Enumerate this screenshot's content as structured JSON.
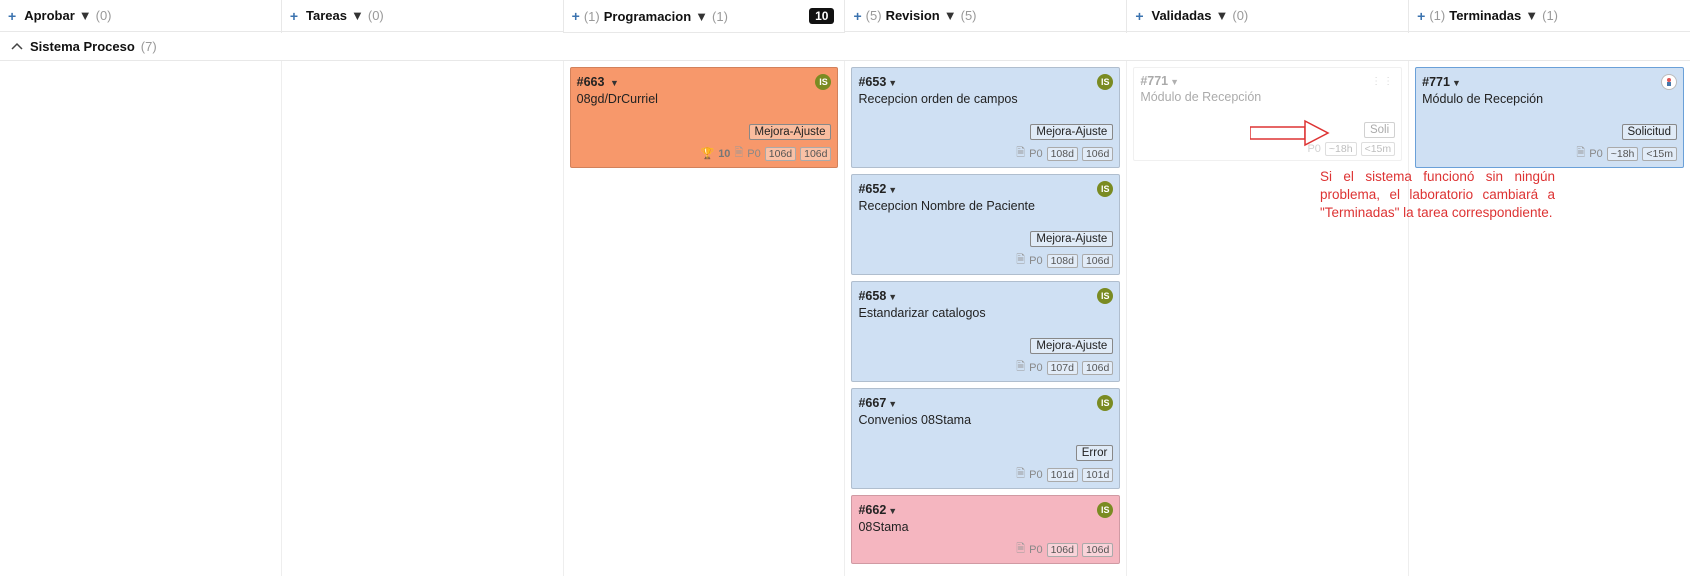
{
  "columns": [
    {
      "title": "Aprobar",
      "pre": "",
      "post": "(0)",
      "badge": ""
    },
    {
      "title": "Tareas",
      "pre": "",
      "post": "(0)",
      "badge": ""
    },
    {
      "title": "Programacion",
      "pre": "(1)",
      "post": "(1)",
      "badge": "10"
    },
    {
      "title": "Revision",
      "pre": "(5)",
      "post": "(5)",
      "badge": ""
    },
    {
      "title": "Validadas",
      "pre": "",
      "post": "(0)",
      "badge": ""
    },
    {
      "title": "Terminadas",
      "pre": "(1)",
      "post": "(1)",
      "badge": ""
    }
  ],
  "swimlane": {
    "name": "Sistema Proceso",
    "count": "(7)"
  },
  "cards": {
    "programacion": [
      {
        "id": "#663",
        "title": "08gd/DrCurriel",
        "tag": "Mejora-Ajuste",
        "avatar": "IS",
        "trophy": true,
        "points": "10",
        "prio": "P0",
        "pill1": "106d",
        "pill2": "106d",
        "color": "orange"
      }
    ],
    "revision": [
      {
        "id": "#653",
        "title": "Recepcion orden de campos",
        "tag": "Mejora-Ajuste",
        "avatar": "IS",
        "prio": "P0",
        "pill1": "108d",
        "pill2": "106d",
        "color": "blue"
      },
      {
        "id": "#652",
        "title": "Recepcion Nombre de Paciente",
        "tag": "Mejora-Ajuste",
        "avatar": "IS",
        "prio": "P0",
        "pill1": "108d",
        "pill2": "106d",
        "color": "blue"
      },
      {
        "id": "#658",
        "title": "Estandarizar catalogos",
        "tag": "Mejora-Ajuste",
        "avatar": "IS",
        "prio": "P0",
        "pill1": "107d",
        "pill2": "106d",
        "color": "blue"
      },
      {
        "id": "#667",
        "title": "Convenios 08Stama",
        "tag": "Error",
        "avatar": "IS",
        "prio": "P0",
        "pill1": "101d",
        "pill2": "101d",
        "color": "blue"
      },
      {
        "id": "#662",
        "title": "08Stama",
        "tag": "",
        "avatar": "IS",
        "prio": "P0",
        "pill1": "106d",
        "pill2": "106d",
        "color": "pink"
      }
    ],
    "validadas_ghost": {
      "id": "#771",
      "title": "Módulo de Recepción",
      "tag": "Soli",
      "prio": "P0",
      "pill1": "~18h",
      "pill2": "<15m",
      "color": "ghost"
    },
    "terminadas": [
      {
        "id": "#771",
        "title": "Módulo de Recepción",
        "tag": "Solicitud",
        "avatarAlt": true,
        "prio": "P0",
        "pill1": "~18h",
        "pill2": "<15m",
        "color": "blue"
      }
    ]
  },
  "annotation": "Si el sistema funcionó sin ningún problema, el laboratorio cambiará a \"Terminadas\" la tarea correspondiente."
}
